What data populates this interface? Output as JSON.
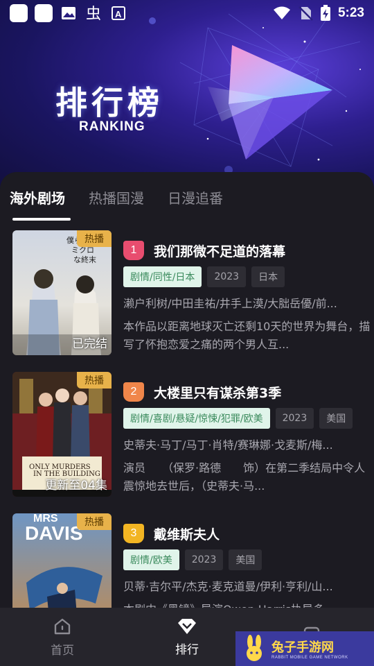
{
  "status_bar": {
    "time": "5:23"
  },
  "hero": {
    "title": "排行榜",
    "subtitle": "RANKING"
  },
  "tabs": [
    {
      "label": "海外剧场",
      "active": true
    },
    {
      "label": "热播国漫",
      "active": false
    },
    {
      "label": "日漫追番",
      "active": false
    }
  ],
  "items": [
    {
      "rank": "1",
      "rank_color": "#e84d6f",
      "badge": "热播",
      "poster_caption": "已完结",
      "title": "我们那微不足道的落幕",
      "genre": "剧情/同性/日本",
      "year": "2023",
      "region": "日本",
      "cast": "濑户利树/中田圭祐/井手上漠/大朏岳優/前...",
      "description": "本作品以距离地球灭亡还剩10天的世界为舞台，描写了怀抱恋爱之痛的两个男人互..."
    },
    {
      "rank": "2",
      "rank_color": "#f0864a",
      "badge": "热播",
      "poster_caption": "更新至04集",
      "title": "大楼里只有谋杀第3季",
      "genre": "剧情/喜剧/悬疑/惊悚/犯罪/欧美",
      "year": "2023",
      "region": "美国",
      "cast": "史蒂夫·马丁/马丁·肖特/赛琳娜·戈麦斯/梅...",
      "description": "演员　　（保罗·路德　　饰）在第二季结局中令人震惊地去世后，（史蒂夫·马..."
    },
    {
      "rank": "3",
      "rank_color": "#f2b523",
      "badge": "热播",
      "poster_caption": "",
      "title": "戴维斯夫人",
      "genre": "剧情/欧美",
      "year": "2023",
      "region": "美国",
      "cast": "贝蒂·吉尔平/杰克·麦克道曼/伊利·亨利/山...",
      "description": "本剧中《黑镜》导演Owen Harris执导多..."
    }
  ],
  "nav": [
    {
      "label": "首页",
      "icon": "home-icon",
      "active": false
    },
    {
      "label": "排行",
      "icon": "ranking-diamond-icon",
      "active": true
    },
    {
      "label": "",
      "icon": "mine-icon",
      "active": false
    }
  ],
  "watermark": {
    "main": "兔子手游网",
    "small": "RABBIT MOBILE GAME NETWORK"
  }
}
